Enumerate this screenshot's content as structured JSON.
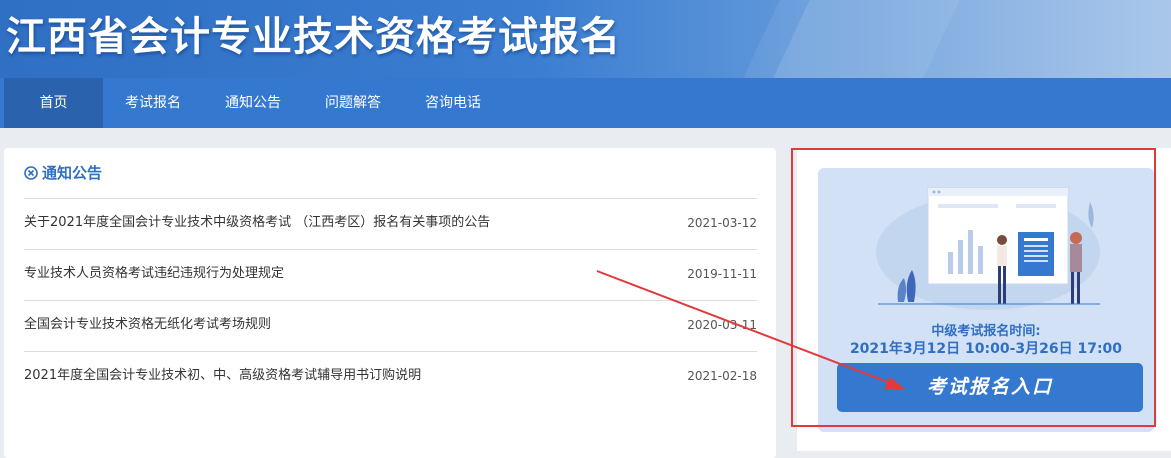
{
  "header": {
    "site_title": "江西省会计专业技术资格考试报名"
  },
  "nav": {
    "items": [
      {
        "label": "首页",
        "active": true
      },
      {
        "label": "考试报名",
        "active": false
      },
      {
        "label": "通知公告",
        "active": false
      },
      {
        "label": "问题解答",
        "active": false
      },
      {
        "label": "咨询电话",
        "active": false
      }
    ]
  },
  "notices": {
    "title": "通知公告",
    "icon": "settings-circle-icon",
    "items": [
      {
        "title": "关于2021年度全国会计专业技术中级资格考试 （江西考区）报名有关事项的公告",
        "date": "2021-03-12"
      },
      {
        "title": "专业技术人员资格考试违纪违规行为处理规定",
        "date": "2019-11-11"
      },
      {
        "title": "全国会计专业技术资格无纸化考试考场规则",
        "date": "2020-03-11"
      },
      {
        "title": "2021年度全国会计专业技术初、中、高级资格考试辅导用书订购说明",
        "date": "2021-02-18"
      }
    ]
  },
  "registration": {
    "time_label": "中级考试报名时间:",
    "time_value": "2021年3月12日 10:00-3月26日 17:00",
    "button_label": "考试报名入口"
  },
  "colors": {
    "primary": "#3479cf",
    "nav_active": "#2a62ad",
    "card_bg": "#d2e1f5",
    "annotation_red": "#e23a3a"
  }
}
